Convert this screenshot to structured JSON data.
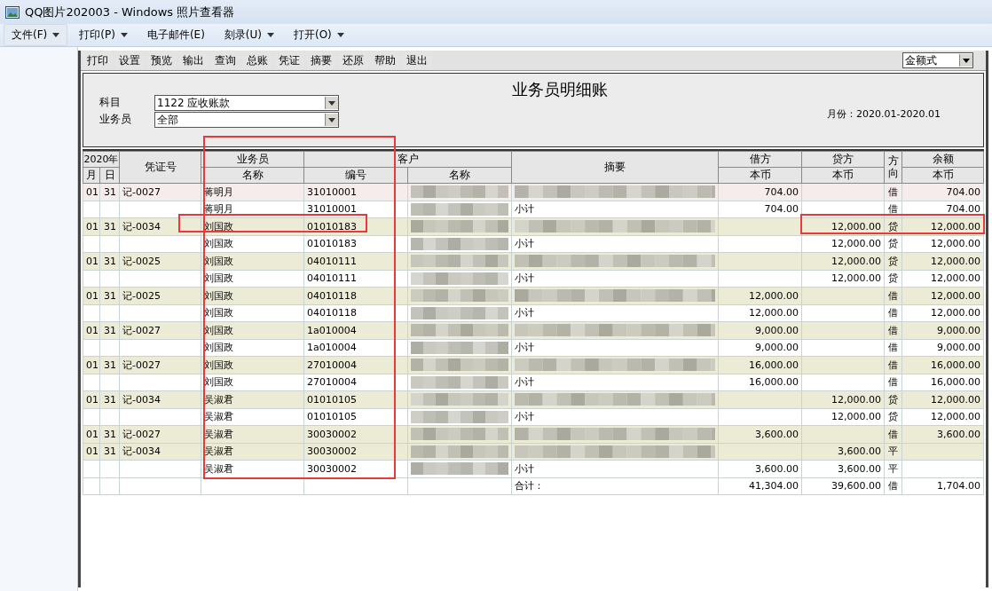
{
  "window": {
    "title": "QQ图片202003 - Windows 照片查看器"
  },
  "menu": [
    {
      "label": "文件(F)",
      "dropdown": true,
      "selected": true
    },
    {
      "label": "打印(P)",
      "dropdown": true,
      "selected": false
    },
    {
      "label": "电子邮件(E)",
      "dropdown": false,
      "selected": false
    },
    {
      "label": "刻录(U)",
      "dropdown": true,
      "selected": false
    },
    {
      "label": "打开(O)",
      "dropdown": true,
      "selected": false
    }
  ],
  "toolbar": [
    "打印",
    "设置",
    "预览",
    "输出",
    "查询",
    "总账",
    "凭证",
    "摘要",
    "还原",
    "帮助",
    "退出"
  ],
  "view_mode": "金额式",
  "report": {
    "title": "业务员明细账",
    "fields": [
      {
        "label": "科目",
        "value": "1122 应收账款"
      },
      {
        "label": "业务员",
        "value": "全部"
      }
    ],
    "period": "月份：2020.01-2020.01"
  },
  "table": {
    "header": {
      "year": "2020年",
      "month": "月",
      "day": "日",
      "voucher": "凭证号",
      "salesperson": "业务员",
      "salesperson_name": "名称",
      "customer": "客户",
      "customer_code": "编号",
      "customer_name": "名称",
      "summary": "摘要",
      "debit": "借方",
      "debit_sub": "本币",
      "credit": "贷方",
      "credit_sub": "本币",
      "direction": "方向",
      "balance": "余额",
      "balance_sub": "本币"
    },
    "rows": [
      {
        "kind": "entry",
        "selected": true,
        "month": "01",
        "day": "31",
        "voucher": "记-0027",
        "salesperson": "蒋明月",
        "code": "31010001",
        "customer_blurred": true,
        "summary_blurred": true,
        "debit": "704.00",
        "direction": "借",
        "balance": "704.00"
      },
      {
        "kind": "subtotal",
        "selected": false,
        "salesperson": "蒋明月",
        "code": "31010001",
        "customer_blurred": true,
        "summary": "小计",
        "debit": "704.00",
        "direction": "借",
        "balance": "704.00"
      },
      {
        "kind": "entry",
        "selected": false,
        "month": "01",
        "day": "31",
        "voucher": "记-0034",
        "salesperson": "刘国政",
        "code": "01010183",
        "customer_blurred": true,
        "summary_blurred": true,
        "credit": "12,000.00",
        "direction": "贷",
        "balance": "12,000.00"
      },
      {
        "kind": "subtotal",
        "selected": false,
        "salesperson": "刘国政",
        "code": "01010183",
        "customer_blurred": true,
        "summary": "小计",
        "credit": "12,000.00",
        "direction": "贷",
        "balance": "12,000.00"
      },
      {
        "kind": "entry",
        "selected": false,
        "month": "01",
        "day": "31",
        "voucher": "记-0025",
        "salesperson": "刘国政",
        "code": "04010111",
        "customer_blurred": true,
        "summary_blurred": true,
        "credit": "12,000.00",
        "direction": "贷",
        "balance": "12,000.00"
      },
      {
        "kind": "subtotal",
        "selected": false,
        "salesperson": "刘国政",
        "code": "04010111",
        "customer_blurred": true,
        "summary": "小计",
        "credit": "12,000.00",
        "direction": "贷",
        "balance": "12,000.00"
      },
      {
        "kind": "entry",
        "selected": false,
        "month": "01",
        "day": "31",
        "voucher": "记-0025",
        "salesperson": "刘国政",
        "code": "04010118",
        "customer_blurred": true,
        "summary_blurred": true,
        "debit": "12,000.00",
        "direction": "借",
        "balance": "12,000.00"
      },
      {
        "kind": "subtotal",
        "selected": false,
        "salesperson": "刘国政",
        "code": "04010118",
        "customer_blurred": true,
        "summary": "小计",
        "debit": "12,000.00",
        "direction": "借",
        "balance": "12,000.00"
      },
      {
        "kind": "entry",
        "selected": false,
        "month": "01",
        "day": "31",
        "voucher": "记-0027",
        "salesperson": "刘国政",
        "code": "1a010004",
        "customer_blurred": true,
        "summary_blurred": true,
        "debit": "9,000.00",
        "direction": "借",
        "balance": "9,000.00"
      },
      {
        "kind": "subtotal",
        "selected": false,
        "salesperson": "刘国政",
        "code": "1a010004",
        "customer_blurred": true,
        "summary": "小计",
        "debit": "9,000.00",
        "direction": "借",
        "balance": "9,000.00"
      },
      {
        "kind": "entry",
        "selected": false,
        "month": "01",
        "day": "31",
        "voucher": "记-0027",
        "salesperson": "刘国政",
        "code": "27010004",
        "customer_blurred": true,
        "summary_blurred": true,
        "debit": "16,000.00",
        "direction": "借",
        "balance": "16,000.00"
      },
      {
        "kind": "subtotal",
        "selected": false,
        "salesperson": "刘国政",
        "code": "27010004",
        "customer_blurred": true,
        "summary": "小计",
        "debit": "16,000.00",
        "direction": "借",
        "balance": "16,000.00"
      },
      {
        "kind": "entry",
        "selected": false,
        "month": "01",
        "day": "31",
        "voucher": "记-0034",
        "salesperson": "吴淑君",
        "code": "01010105",
        "customer_blurred": true,
        "summary_blurred": true,
        "credit": "12,000.00",
        "direction": "贷",
        "balance": "12,000.00"
      },
      {
        "kind": "subtotal",
        "selected": false,
        "salesperson": "吴淑君",
        "code": "01010105",
        "customer_blurred": true,
        "summary": "小计",
        "credit": "12,000.00",
        "direction": "贷",
        "balance": "12,000.00"
      },
      {
        "kind": "entry",
        "selected": false,
        "month": "01",
        "day": "31",
        "voucher": "记-0027",
        "salesperson": "吴淑君",
        "code": "30030002",
        "customer_blurred": true,
        "summary_blurred": true,
        "debit": "3,600.00",
        "direction": "借",
        "balance": "3,600.00"
      },
      {
        "kind": "entry",
        "selected": false,
        "month": "01",
        "day": "31",
        "voucher": "记-0034",
        "salesperson": "吴淑君",
        "code": "30030002",
        "customer_blurred": true,
        "summary_blurred": true,
        "credit": "3,600.00",
        "direction": "平"
      },
      {
        "kind": "subtotal",
        "selected": false,
        "salesperson": "吴淑君",
        "code": "30030002",
        "customer_blurred": true,
        "summary": "小计",
        "debit": "3,600.00",
        "credit": "3,600.00",
        "direction": "平"
      },
      {
        "kind": "total",
        "selected": false,
        "summary": "合计：",
        "debit": "41,304.00",
        "credit": "39,600.00",
        "direction": "借",
        "balance": "1,704.00"
      }
    ]
  }
}
